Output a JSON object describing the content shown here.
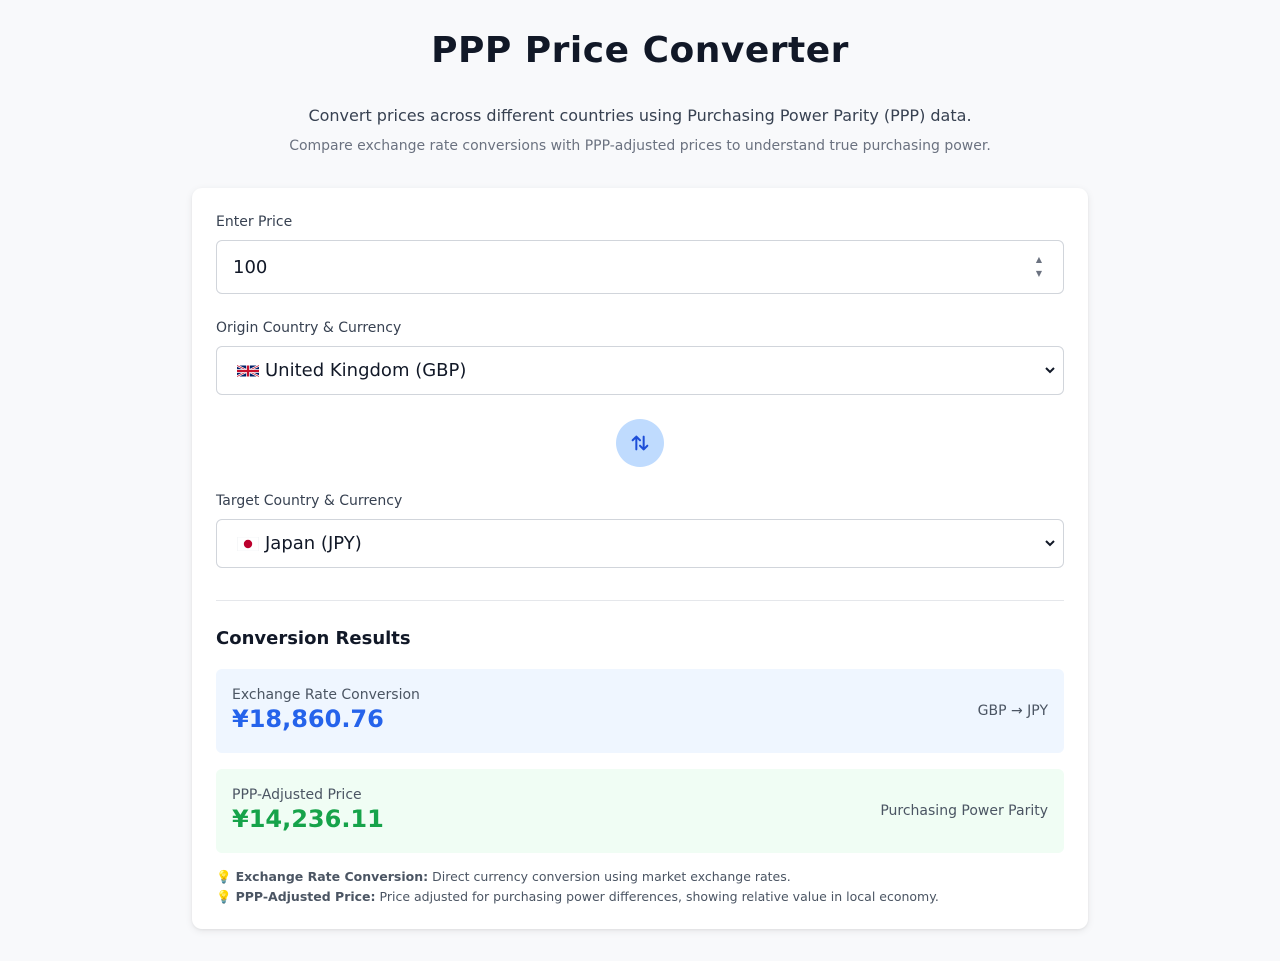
{
  "header": {
    "title": "PPP Price Converter",
    "subtitle": "Convert prices across different countries using Purchasing Power Parity (PPP) data.",
    "subtitle2": "Compare exchange rate conversions with PPP-adjusted prices to understand true purchasing power."
  },
  "form": {
    "price_label": "Enter Price",
    "price_value": "100",
    "origin_label": "Origin Country & Currency",
    "origin_value": "United Kingdom (GBP)",
    "origin_flag": "uk-flag-icon",
    "target_label": "Target Country & Currency",
    "target_value": "Japan (JPY)",
    "target_flag": "japan-flag-icon",
    "swap_icon": "swap-arrows-icon"
  },
  "results": {
    "title": "Conversion Results",
    "exchange": {
      "label": "Exchange Rate Conversion",
      "value": "¥18,860.76",
      "side": "GBP → JPY"
    },
    "ppp": {
      "label": "PPP-Adjusted Price",
      "value": "¥14,236.11",
      "side": "Purchasing Power Parity"
    }
  },
  "notes": [
    {
      "term": "Exchange Rate Conversion:",
      "text": "Direct currency conversion using market exchange rates."
    },
    {
      "term": "PPP-Adjusted Price:",
      "text": "Price adjusted for purchasing power differences, showing relative value in local economy."
    }
  ],
  "colors": {
    "accent": "#2563eb",
    "success": "#16a34a",
    "swap_bg": "#bfdbfe"
  }
}
